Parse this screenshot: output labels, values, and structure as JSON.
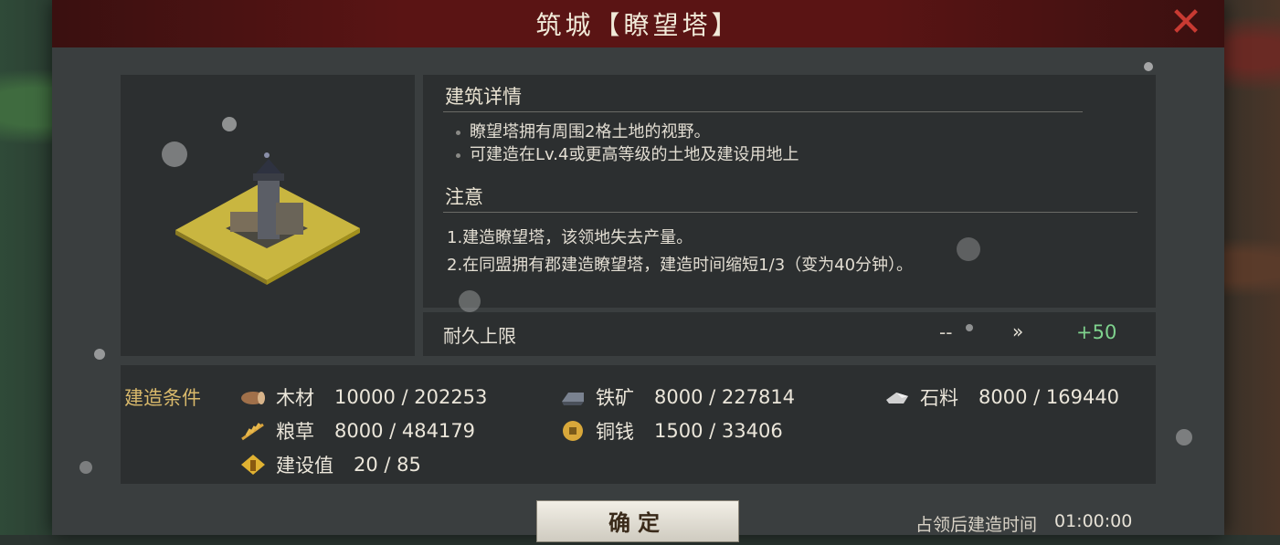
{
  "dialog": {
    "title": "筑城【瞭望塔】"
  },
  "details": {
    "heading": "建筑详情",
    "lines": [
      "瞭望塔拥有周围2格土地的视野。",
      "可建造在Lv.4或更高等级的土地及建设用地上"
    ]
  },
  "notes": {
    "heading": "注意",
    "lines": [
      "1.建造瞭望塔，该领地失去产量。",
      "2.在同盟拥有郡建造瞭望塔，建造时间缩短1/3（变为40分钟）。"
    ]
  },
  "durability": {
    "label": "耐久上限",
    "current": "--",
    "arrow": "»",
    "new_value": "+50"
  },
  "conditions": {
    "title": "建造条件",
    "resources": [
      {
        "icon": "wood-icon",
        "name": "木材",
        "value": "10000 / 202253"
      },
      {
        "icon": "iron-ore-icon",
        "name": "铁矿",
        "value": "8000 / 227814"
      },
      {
        "icon": "stone-icon",
        "name": "石料",
        "value": "8000 / 169440"
      },
      {
        "icon": "grain-icon",
        "name": "粮草",
        "value": "8000 / 484179"
      },
      {
        "icon": "copper-coin-icon",
        "name": "铜钱",
        "value": "1500 / 33406"
      },
      {
        "icon": "construction-value-icon",
        "name": "建设值",
        "value": "20 / 85"
      }
    ]
  },
  "footer": {
    "confirm_label": "确定",
    "time_label": "占领后建造时间",
    "time_value": "01:00:00"
  },
  "colors": {
    "title_bar": "#5a1414",
    "close": "#c83a32",
    "condition_title": "#d9b96b",
    "positive": "#7fd38e"
  }
}
